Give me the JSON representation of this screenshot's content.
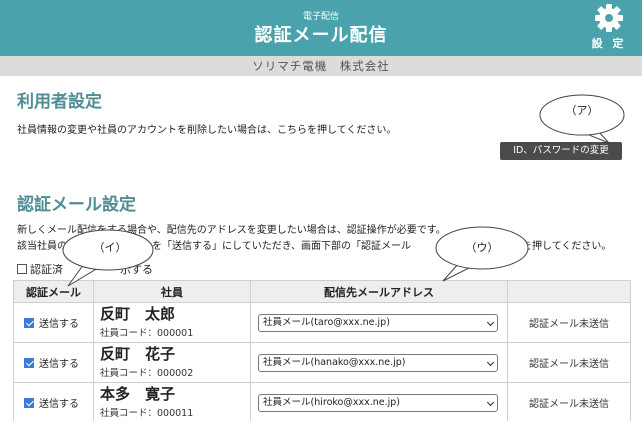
{
  "header": {
    "subtitle": "電子配信",
    "title": "認証メール配信",
    "settings_label": "設 定"
  },
  "company": "ソリマチ電機　株式会社",
  "user_section": {
    "title": "利用者設定",
    "description": "社員情報の変更や社員のアカウントを削除したい場合は、こちらを押してください。",
    "button_label": "ID、パスワードの変更"
  },
  "auth_section": {
    "title": "認証メール設定",
    "line1": "新しくメール配信をする場合や、配信先のアドレスを変更したい場合は、認証操作が必要です。",
    "line2_a": "該当社員の",
    "line2_b": "を「送信する」にしていただき、画面下部の「認証メール",
    "line2_c": "を押してください。",
    "filter_a": "認証済",
    "filter_b": "示する"
  },
  "table": {
    "headers": [
      "認証メール",
      "社員",
      "配信先メールアドレス",
      ""
    ],
    "rows": [
      {
        "send_label": "送信する",
        "name": "反町　太郎",
        "code": "社員コード：000001",
        "email": "社員メール(taro@xxx.ne.jp)",
        "status": "認証メール未送信"
      },
      {
        "send_label": "送信する",
        "name": "反町　花子",
        "code": "社員コード：000002",
        "email": "社員メール(hanako@xxx.ne.jp)",
        "status": "認証メール未送信"
      },
      {
        "send_label": "送信する",
        "name": "本多　寛子",
        "code": "社員コード：000011",
        "email": "社員メール(hiroko@xxx.ne.jp)",
        "status": "認証メール未送信"
      }
    ]
  },
  "callouts": {
    "a": "（ア）",
    "i": "（イ）",
    "u": "（ウ）"
  }
}
